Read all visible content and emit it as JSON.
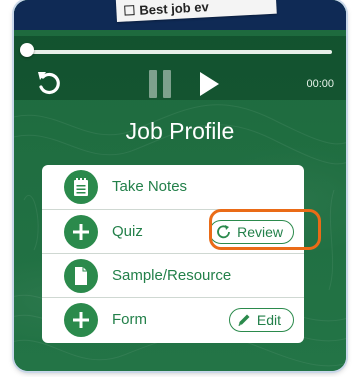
{
  "header": {
    "paper_text": "Best job ev"
  },
  "player": {
    "time": "00:00",
    "progress": 0.0,
    "icons": [
      "replay-icon",
      "pause-icon",
      "play-icon"
    ]
  },
  "page": {
    "title": "Job Profile"
  },
  "menu": {
    "items": [
      {
        "label": "Take Notes",
        "icon": "notepad-icon"
      },
      {
        "label": "Quiz",
        "icon": "plus-icon",
        "action": "Review",
        "action_icon": "refresh-icon"
      },
      {
        "label": "Sample/Resource",
        "icon": "document-icon"
      },
      {
        "label": "Form",
        "icon": "plus-icon",
        "action": "Edit",
        "action_icon": "pencil-icon"
      }
    ]
  },
  "colors": {
    "background": "#1f6b3e",
    "accent": "#2b8a4c",
    "highlight": "#ea6b17"
  }
}
